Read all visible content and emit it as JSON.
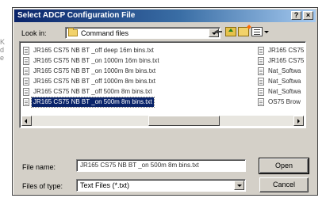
{
  "dialog": {
    "title": "Select ADCP Configuration File",
    "help_glyph": "?",
    "close_glyph": "×"
  },
  "look_in": {
    "label": "Look in:",
    "value": "Command files"
  },
  "files": {
    "left_column": [
      "JR165 CS75 NB BT _off deep 16m bins.txt",
      "JR165 CS75 NB BT _on 1000m 16m bins.txt",
      "JR165 CS75 NB BT _on 1000m 8m bins.txt",
      "JR165 CS75 NB BT _off 1000m 8m bins.txt",
      "JR165 CS75 NB BT _off 500m 8m bins.txt",
      "JR165 CS75 NB BT _on 500m 8m bins.txt"
    ],
    "right_column": [
      "JR165 CS75",
      "JR165 CS75",
      "Nat_Softwa",
      "Nat_Softwa",
      "Nat_Softwa",
      "OS75   Brow"
    ],
    "selected_index": 5
  },
  "file_name": {
    "label": "File name:",
    "value": "JR165 CS75 NB BT _on 500m 8m bins.txt"
  },
  "file_type": {
    "label": "Files of type:",
    "value": "Text Files (*.txt)"
  },
  "buttons": {
    "open": "Open",
    "cancel": "Cancel"
  },
  "left_margin_text": "K\nd\ne"
}
